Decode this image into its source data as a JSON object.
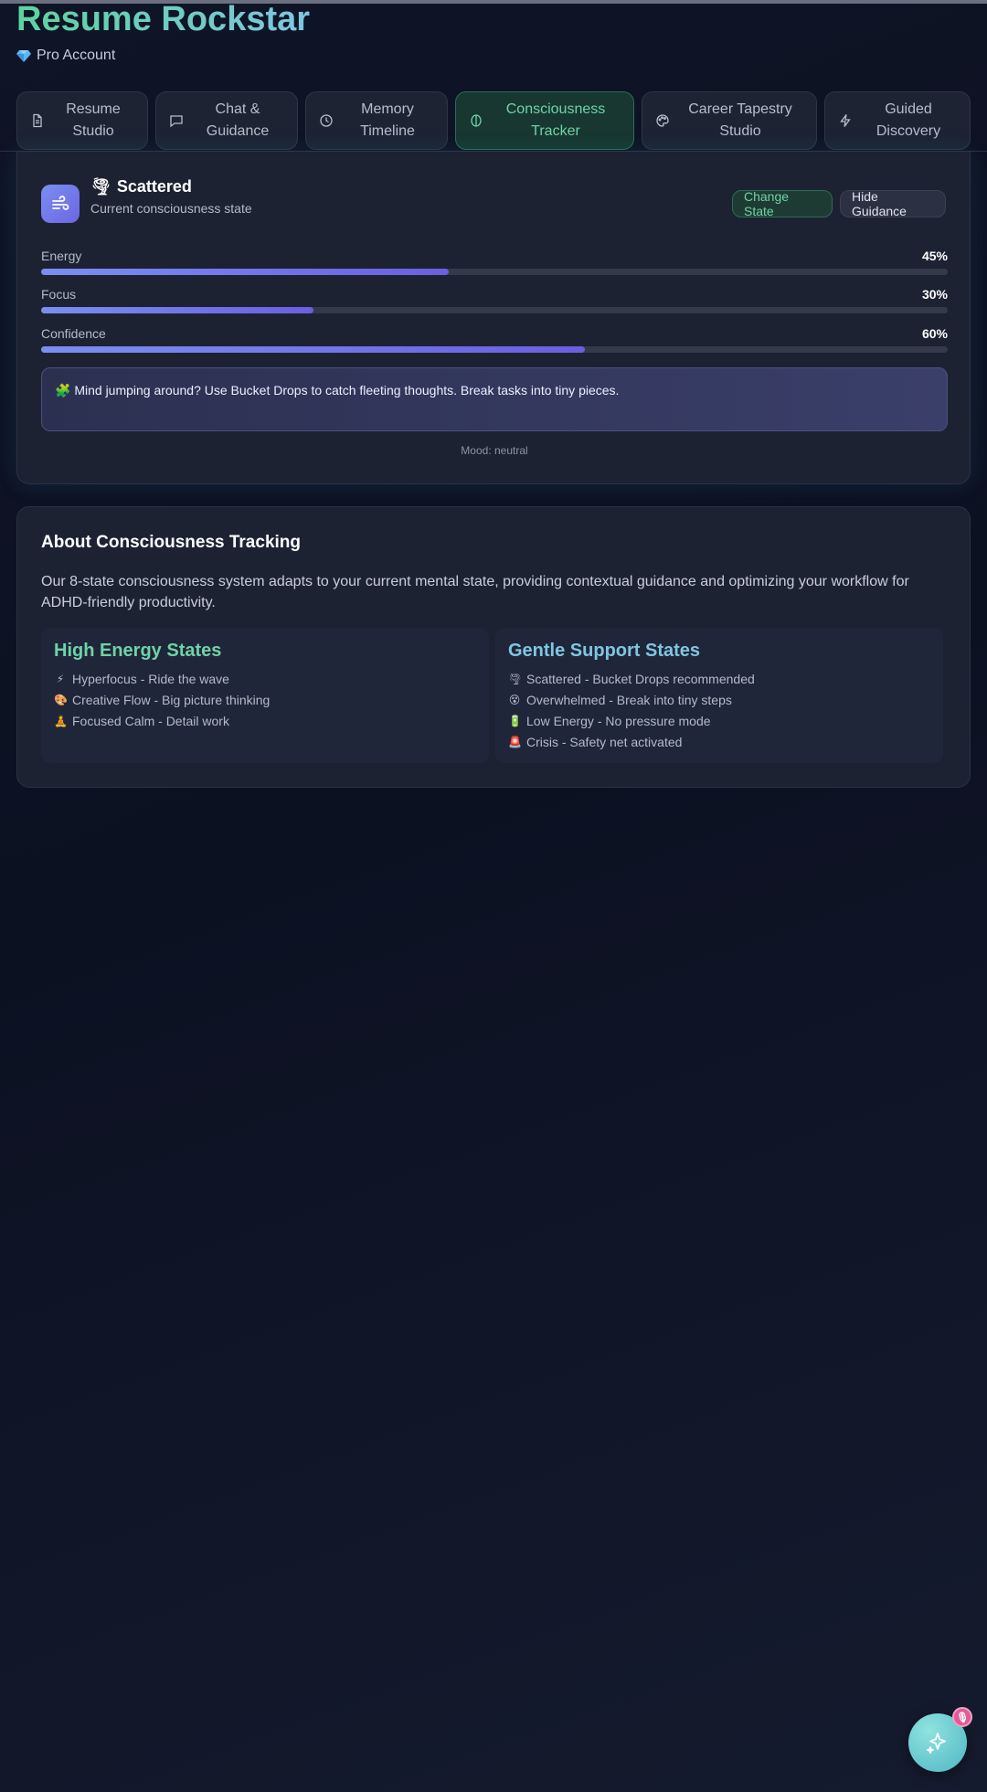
{
  "app": {
    "title": "Resume Rockstar",
    "account": "Pro Account"
  },
  "tabs": [
    {
      "label": "Resume Studio",
      "icon": "document-icon",
      "active": false
    },
    {
      "label": "Chat & Guidance",
      "icon": "chat-icon",
      "active": false
    },
    {
      "label": "Memory Timeline",
      "icon": "clock-icon",
      "active": false
    },
    {
      "label": "Consciousness Tracker",
      "icon": "brain-icon",
      "active": true
    },
    {
      "label": "Career Tapestry Studio",
      "icon": "palette-icon",
      "active": false
    },
    {
      "label": "Guided Discovery",
      "icon": "lightning-icon",
      "active": false
    }
  ],
  "tracker": {
    "state_name": "Scattered",
    "state_subtitle": "Current consciousness state",
    "change_state_label": "Change State",
    "hide_guidance_label": "Hide Guidance",
    "metrics": [
      {
        "label": "Energy",
        "value_text": "45%",
        "value": 45
      },
      {
        "label": "Focus",
        "value_text": "30%",
        "value": 30
      },
      {
        "label": "Confidence",
        "value_text": "60%",
        "value": 60
      }
    ],
    "guidance": "Mind jumping around? Use Bucket Drops to catch fleeting thoughts. Break tasks into tiny pieces.",
    "mood": "Mood: neutral"
  },
  "about": {
    "title": "About Consciousness Tracking",
    "description": "Our 8-state consciousness system adapts to your current mental state, providing contextual guidance and optimizing your workflow for ADHD-friendly productivity.",
    "high_energy": {
      "title": "High Energy States",
      "items": [
        {
          "emoji": "⚡",
          "text": "Hyperfocus - Ride the wave"
        },
        {
          "emoji": "🎨",
          "text": "Creative Flow - Big picture thinking"
        },
        {
          "emoji": "🧘",
          "text": "Focused Calm - Detail work"
        }
      ]
    },
    "gentle_support": {
      "title": "Gentle Support States",
      "items": [
        {
          "emoji": "🌪",
          "text": "Scattered - Bucket Drops recommended"
        },
        {
          "emoji": "😵",
          "text": "Overwhelmed - Break into tiny steps"
        },
        {
          "emoji": "🔋",
          "text": "Low Energy - No pressure mode"
        },
        {
          "emoji": "🚨",
          "text": "Crisis - Safety net activated"
        }
      ]
    }
  },
  "fab": {
    "icon": "sparkles-icon",
    "badge_icon": "microphone-icon"
  },
  "colors": {
    "accent_green": "#6fd3a6",
    "accent_blue": "#7fc6e0",
    "bar_fill": "#6a5fe0",
    "background": "#0f1426"
  }
}
